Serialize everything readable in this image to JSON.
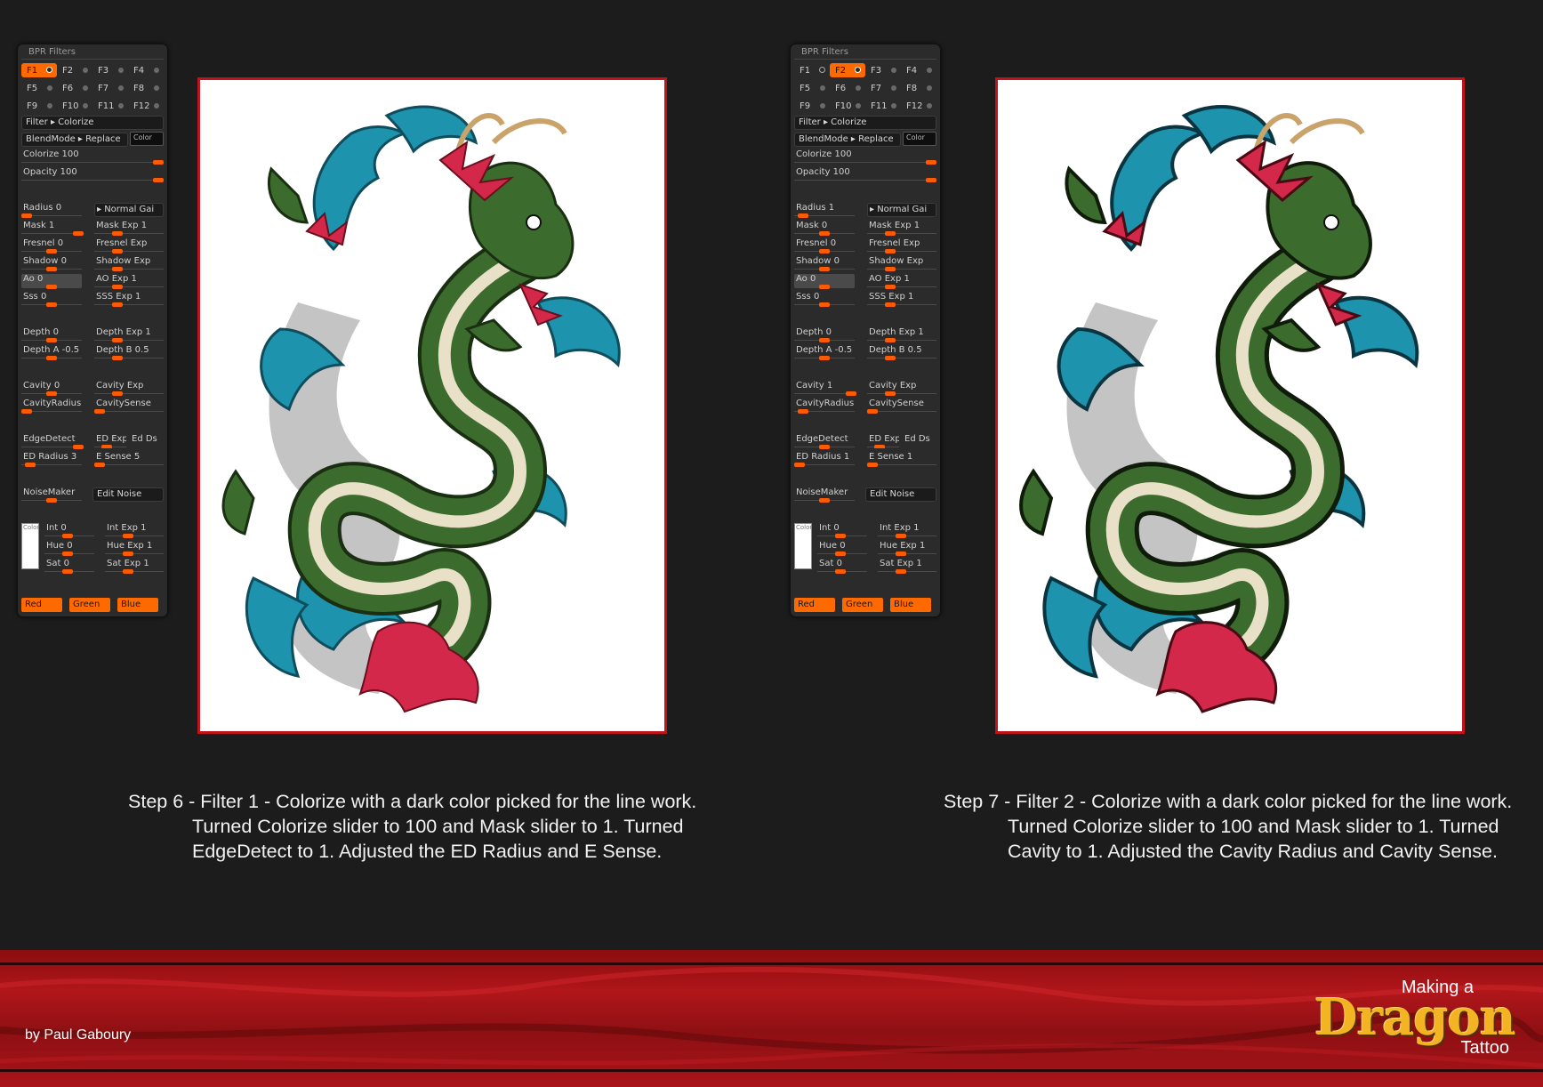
{
  "panels": [
    {
      "title": "BPR Filters",
      "filters": [
        "F1",
        "F2",
        "F3",
        "F4",
        "F5",
        "F6",
        "F7",
        "F8",
        "F9",
        "F10",
        "F11",
        "F12"
      ],
      "selected_filter": "F1",
      "filter_field": "Filter ▸ Colorize",
      "blendmode_field": "BlendMode ▸ Replace",
      "color_chip": "Color",
      "colorize": "Colorize 100",
      "opacity": "Opacity 100",
      "radius": "Radius 0",
      "normal_gai": "▸ Normal Gai",
      "mask": "Mask 1",
      "mask_exp": "Mask Exp 1",
      "fresnel": "Fresnel 0",
      "fresnel_exp": "Fresnel Exp",
      "shadow": "Shadow 0",
      "shadow_exp": "Shadow Exp",
      "ao": "Ao 0",
      "ao_exp": "AO Exp 1",
      "sss": "Sss 0",
      "sss_exp": "SSS Exp 1",
      "depth": "Depth 0",
      "depth_exp": "Depth Exp 1",
      "depth_a": "Depth A -0.5",
      "depth_b": "Depth B 0.5",
      "cavity": "Cavity 0",
      "cavity_exp": "Cavity Exp",
      "cavity_radius": "CavityRadius",
      "cavity_sense": "CavitySense",
      "edge_detect": "EdgeDetect",
      "ed_exp": "ED Exp",
      "ed_ds": "Ed Ds",
      "ed_radius": "ED Radius 3",
      "e_sense": "E Sense 5",
      "noisemaker": "NoiseMaker",
      "edit_noise": "Edit Noise",
      "swatch_label": "Color",
      "int": "Int 0",
      "int_exp": "Int Exp 1",
      "hue": "Hue 0",
      "hue_exp": "Hue Exp 1",
      "sat": "Sat 0",
      "sat_exp": "Sat Exp 1",
      "red": "Red",
      "green": "Green",
      "blue": "Blue"
    },
    {
      "title": "BPR Filters",
      "filters": [
        "F1",
        "F2",
        "F3",
        "F4",
        "F5",
        "F6",
        "F7",
        "F8",
        "F9",
        "F10",
        "F11",
        "F12"
      ],
      "selected_filter": "F2",
      "filter_field": "Filter ▸ Colorize",
      "blendmode_field": "BlendMode ▸ Replace",
      "color_chip": "Color",
      "colorize": "Colorize 100",
      "opacity": "Opacity 100",
      "radius": "Radius 1",
      "normal_gai": "▸ Normal Gai",
      "mask": "Mask 0",
      "mask_exp": "Mask Exp 1",
      "fresnel": "Fresnel 0",
      "fresnel_exp": "Fresnel Exp",
      "shadow": "Shadow 0",
      "shadow_exp": "Shadow Exp",
      "ao": "Ao 0",
      "ao_exp": "AO Exp 1",
      "sss": "Sss 0",
      "sss_exp": "SSS Exp 1",
      "depth": "Depth 0",
      "depth_exp": "Depth Exp 1",
      "depth_a": "Depth A -0.5",
      "depth_b": "Depth B 0.5",
      "cavity": "Cavity 1",
      "cavity_exp": "Cavity Exp",
      "cavity_radius": "CavityRadius",
      "cavity_sense": "CavitySense",
      "edge_detect": "EdgeDetect",
      "ed_exp": "ED Exp",
      "ed_ds": "Ed Ds",
      "ed_radius": "ED Radius 1",
      "e_sense": "E Sense 1",
      "noisemaker": "NoiseMaker",
      "edit_noise": "Edit Noise",
      "swatch_label": "Color",
      "int": "Int 0",
      "int_exp": "Int Exp 1",
      "hue": "Hue 0",
      "hue_exp": "Hue Exp 1",
      "sat": "Sat 0",
      "sat_exp": "Sat Exp 1",
      "red": "Red",
      "green": "Green",
      "blue": "Blue"
    }
  ],
  "captions": [
    {
      "line1": "Step 6 - Filter 1 - Colorize with a dark color picked for the line work.",
      "line2": "Turned Colorize slider to 100 and Mask slider to 1. Turned",
      "line3": "EdgeDetect to 1. Adjusted the ED Radius and E Sense."
    },
    {
      "line1": "Step 7 - Filter 2 - Colorize with a dark color picked for the line work.",
      "line2": "Turned Colorize slider to 100 and Mask slider to 1. Turned",
      "line3": "Cavity to 1. Adjusted the Cavity Radius and Cavity Sense."
    }
  ],
  "footer": {
    "byline": "by Paul Gaboury",
    "logo_making": "Making a",
    "logo_dragon": "Dragon",
    "logo_tattoo": "Tattoo"
  },
  "colors": {
    "accent": "#ff6a00",
    "canvas_border": "#c0141a",
    "dragon_green": "#3c6b2e",
    "dragon_red": "#d4284a",
    "water_teal": "#1d93ad",
    "logo_gold": "#f2b422"
  }
}
